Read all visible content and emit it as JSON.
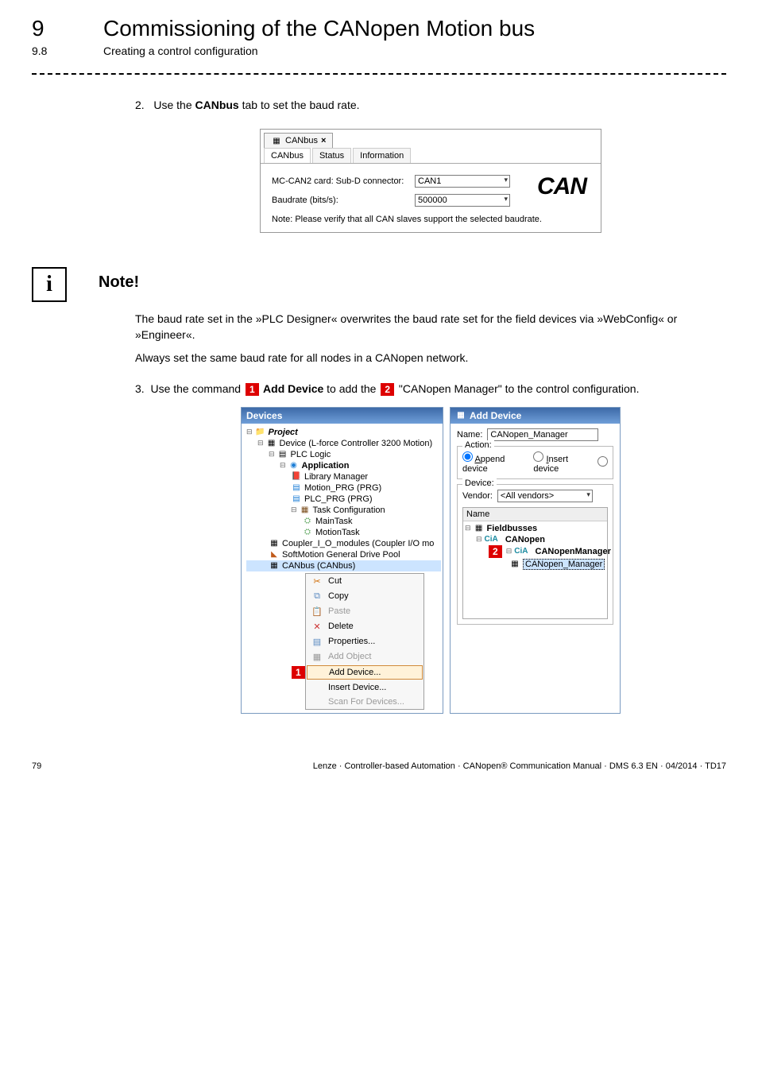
{
  "header": {
    "chapter_num": "9",
    "chapter_title": "Commissioning of the CANopen Motion bus",
    "section_num": "9.8",
    "section_title": "Creating a control configuration"
  },
  "step2": {
    "num": "2.",
    "pre": "Use the ",
    "bold": "CANbus",
    "post": " tab to set the baud rate."
  },
  "canbus_panel": {
    "doc_tab": "CANbus",
    "close_glyph": "×",
    "tabs": {
      "canbus": "CANbus",
      "status": "Status",
      "information": "Information"
    },
    "label_connector": "MC-CAN2 card: Sub-D connector:",
    "val_connector": "CAN1",
    "label_baud": "Baudrate (bits/s):",
    "val_baud": "500000",
    "logo": "CAN",
    "note": "Note: Please verify that all CAN slaves support the selected baudrate."
  },
  "note_block": {
    "icon": "i",
    "title": "Note!",
    "p1": "The baud rate set in the »PLC Designer« overwrites the baud rate set for the field devices via »WebConfig« or »Engineer«.",
    "p2": "Always set the same baud rate for all nodes in a CANopen network."
  },
  "step3": {
    "num": "3.",
    "a": "Use the command ",
    "m1": "1",
    "b": "  Add Device",
    "c": " to add the  ",
    "m2": "2",
    "d": "  \"CANopen Manager\" to the control configuration."
  },
  "devices_panel": {
    "title": "Devices",
    "tree": {
      "project": "Project",
      "device": "Device (L-force Controller 3200 Motion)",
      "plc_logic": "PLC Logic",
      "application": "Application",
      "library_manager": "Library Manager",
      "motion_prg": "Motion_PRG (PRG)",
      "plc_prg": "PLC_PRG (PRG)",
      "task_config": "Task Configuration",
      "main_task": "MainTask",
      "motion_task": "MotionTask",
      "coupler": "Coupler_I_O_modules (Coupler I/O mo",
      "softmotion": "SoftMotion General Drive Pool",
      "canbus": "CANbus (CANbus)"
    },
    "menu": {
      "cut": "Cut",
      "copy": "Copy",
      "paste": "Paste",
      "delete": "Delete",
      "properties": "Properties...",
      "add_object": "Add Object",
      "add_device": "Add Device...",
      "insert_device": "Insert Device...",
      "scan": "Scan For Devices...",
      "marker": "1"
    }
  },
  "add_panel": {
    "title": "Add Device",
    "name_label": "Name:",
    "name_value": "CANopen_Manager",
    "action_legend": "Action:",
    "append": "Append device",
    "insert": "Insert device",
    "device_legend": "Device:",
    "vendor_label": "Vendor:",
    "vendor_value": "<All vendors>",
    "col_name": "Name",
    "fieldbusses": "Fieldbusses",
    "canopen": "CANopen",
    "canopenmanager": "CANopenManager",
    "marker": "2",
    "canopen_manager_leaf": "CANopen_Manager"
  },
  "footer": {
    "page": "79",
    "text": "Lenze · Controller-based Automation · CANopen® Communication Manual · DMS 6.3 EN · 04/2014 · TD17"
  }
}
